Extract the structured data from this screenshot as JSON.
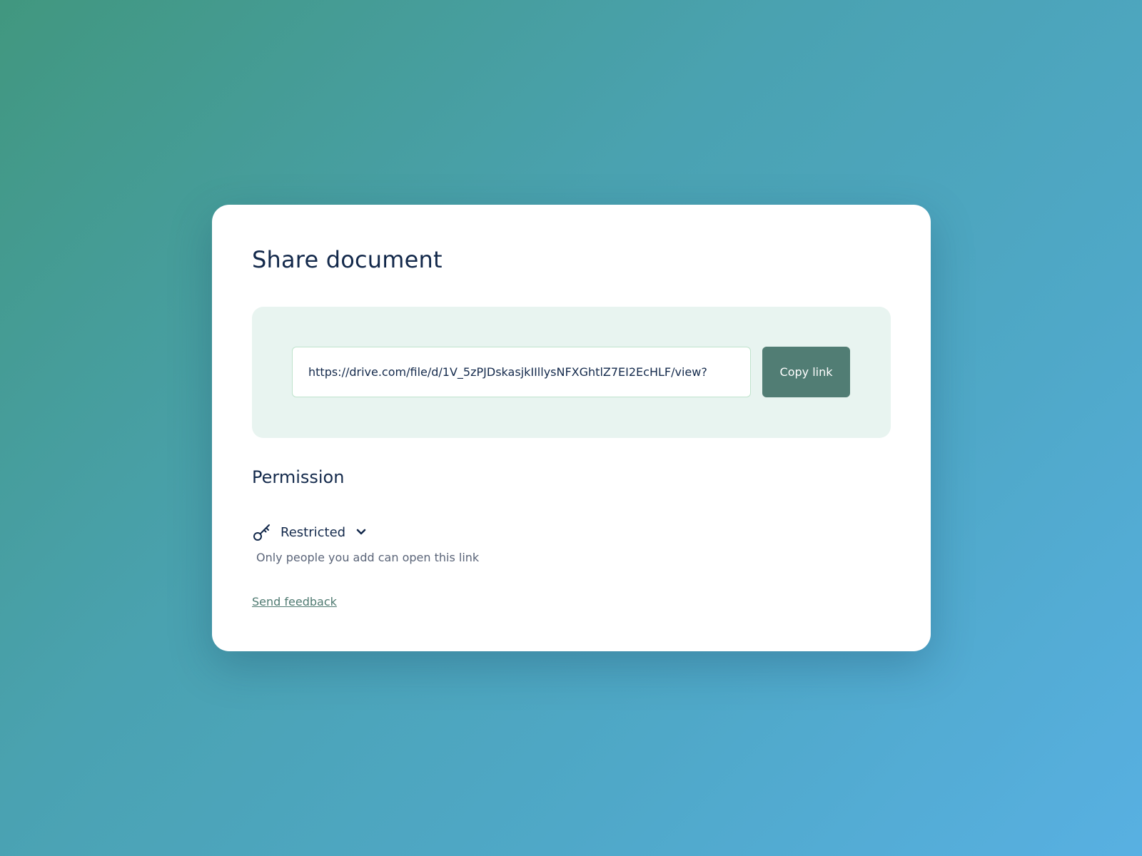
{
  "dialog": {
    "title": "Share document",
    "link": {
      "url": "https://drive.com/file/d/1V_5zPJDskasjkIIllysNFXGhtlZ7EI2EcHLF/view?",
      "copy_label": "Copy link"
    },
    "permission": {
      "section_title": "Permission",
      "selected": "Restricted",
      "description": "Only people you add can open this link",
      "icon": "key-icon"
    },
    "feedback_label": "Send feedback"
  },
  "colors": {
    "accent": "#517d74",
    "panel": "#e8f4f0",
    "text": "#13294b"
  }
}
